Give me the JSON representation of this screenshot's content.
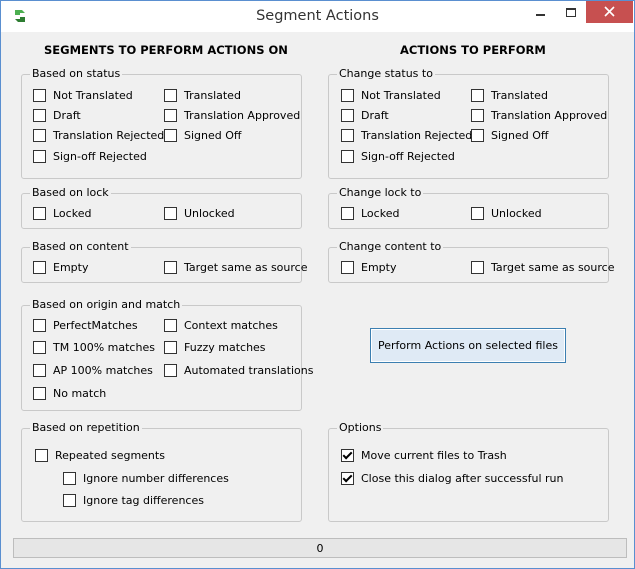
{
  "window": {
    "title": "Segment Actions"
  },
  "left": {
    "heading": "SEGMENTS TO PERFORM ACTIONS ON",
    "status": {
      "legend": "Based on status",
      "items": [
        {
          "label": "Not Translated",
          "checked": false
        },
        {
          "label": "Translated",
          "checked": false
        },
        {
          "label": "Draft",
          "checked": false
        },
        {
          "label": "Translation Approved",
          "checked": false
        },
        {
          "label": "Translation Rejected",
          "checked": false
        },
        {
          "label": "Signed Off",
          "checked": false
        },
        {
          "label": "Sign-off Rejected",
          "checked": false
        }
      ]
    },
    "lock": {
      "legend": "Based on lock",
      "items": [
        {
          "label": "Locked",
          "checked": false
        },
        {
          "label": "Unlocked",
          "checked": false
        }
      ]
    },
    "content": {
      "legend": "Based on content",
      "items": [
        {
          "label": "Empty",
          "checked": false
        },
        {
          "label": "Target same as source",
          "checked": false
        }
      ]
    },
    "origin": {
      "legend": "Based on origin and match",
      "items": [
        {
          "label": "PerfectMatches",
          "checked": false
        },
        {
          "label": "Context matches",
          "checked": false
        },
        {
          "label": "TM 100% matches",
          "checked": false
        },
        {
          "label": "Fuzzy matches",
          "checked": false
        },
        {
          "label": "AP 100% matches",
          "checked": false
        },
        {
          "label": "Automated translations",
          "checked": false
        },
        {
          "label": "No match",
          "checked": false
        }
      ]
    },
    "repetition": {
      "legend": "Based on repetition",
      "items": [
        {
          "label": "Repeated segments",
          "checked": false
        },
        {
          "label": "Ignore number differences",
          "checked": false
        },
        {
          "label": "Ignore tag differences",
          "checked": false
        }
      ]
    }
  },
  "right": {
    "heading": "ACTIONS TO PERFORM",
    "status": {
      "legend": "Change status to",
      "items": [
        {
          "label": "Not Translated",
          "checked": false
        },
        {
          "label": "Translated",
          "checked": false
        },
        {
          "label": "Draft",
          "checked": false
        },
        {
          "label": "Translation Approved",
          "checked": false
        },
        {
          "label": "Translation Rejected",
          "checked": false
        },
        {
          "label": "Signed Off",
          "checked": false
        },
        {
          "label": "Sign-off Rejected",
          "checked": false
        }
      ]
    },
    "lock": {
      "legend": "Change lock to",
      "items": [
        {
          "label": "Locked",
          "checked": false
        },
        {
          "label": "Unlocked",
          "checked": false
        }
      ]
    },
    "content": {
      "legend": "Change content to",
      "items": [
        {
          "label": "Empty",
          "checked": false
        },
        {
          "label": "Target same as source",
          "checked": false
        }
      ]
    },
    "perform_button": "Perform Actions on selected files",
    "options": {
      "legend": "Options",
      "items": [
        {
          "label": "Move current files to Trash",
          "checked": true
        },
        {
          "label": "Close this dialog after successful run",
          "checked": true
        }
      ]
    }
  },
  "status_bar": {
    "count": "0"
  },
  "colors": {
    "close_button": "#c75050",
    "title_border": "#5a8fd0",
    "button_border": "#3c7fb1"
  }
}
